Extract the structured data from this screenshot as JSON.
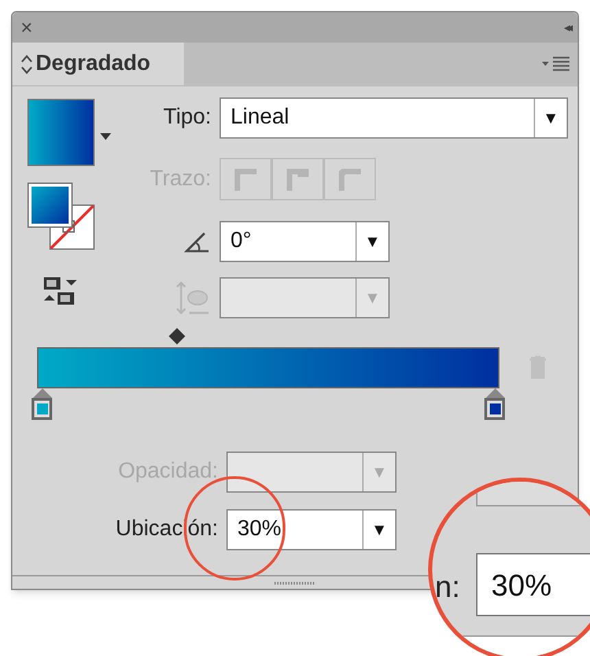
{
  "panel": {
    "close": "×",
    "collapse": "◂◂",
    "tab": {
      "label": "Degradado",
      "selected": true
    }
  },
  "tipo": {
    "label": "Tipo:",
    "value": "Lineal",
    "arrow": "▼"
  },
  "trazo": {
    "label": "Trazo:",
    "disabled": true
  },
  "angle": {
    "value": "0°",
    "arrow": "▼",
    "disabled": false
  },
  "aspect": {
    "value_arrow": "▼",
    "disabled": true
  },
  "stops": [
    {
      "color": "#00aac6",
      "selected": false
    },
    {
      "color": "#0030a0",
      "selected": false
    }
  ],
  "opacidad": {
    "label": "Opacidad:",
    "arrow": "▼",
    "disabled": true
  },
  "ubicacion": {
    "label": "Ubicación:",
    "value": "30%",
    "arrow": "▼",
    "disabled": false
  },
  "callout": {
    "label_fragment": "n:",
    "value": "30%"
  }
}
